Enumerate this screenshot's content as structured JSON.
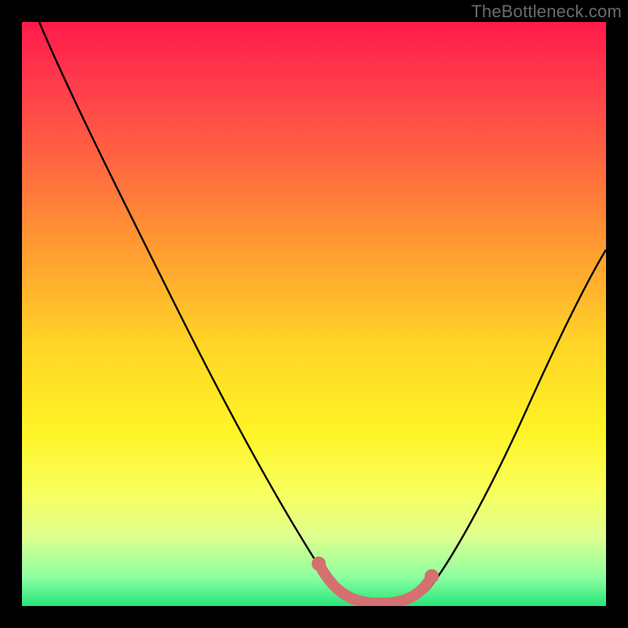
{
  "watermark": "TheBottleneck.com",
  "chart_data": {
    "type": "line",
    "title": "",
    "xlabel": "",
    "ylabel": "",
    "xlim": [
      0,
      100
    ],
    "ylim": [
      0,
      100
    ],
    "series": [
      {
        "name": "curve",
        "color": "#000000",
        "x": [
          3,
          10,
          20,
          30,
          40,
          48,
          52,
          58,
          62,
          66,
          70,
          78,
          88,
          100
        ],
        "y": [
          100,
          86,
          68,
          50,
          30,
          14,
          6,
          1,
          0,
          0,
          1,
          10,
          30,
          58
        ]
      },
      {
        "name": "highlight",
        "color": "#d46a6a",
        "x": [
          51,
          54,
          58,
          62,
          66,
          69,
          71
        ],
        "y": [
          6,
          2,
          0.5,
          0,
          0.5,
          2,
          6
        ]
      }
    ]
  }
}
